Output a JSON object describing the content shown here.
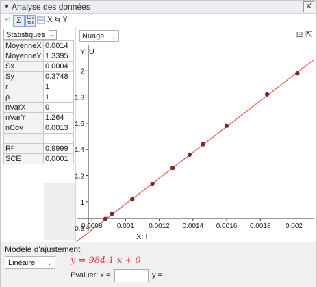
{
  "window": {
    "title": "Analyse des données",
    "collapse_icon": "triangle-down-icon",
    "close_icon": "close-icon"
  },
  "toolbar": {
    "swap_label": "X ⇆ Y"
  },
  "stats": {
    "selector": "Statistiques",
    "rows": [
      {
        "k": "MoyenneX",
        "v": "0.0014"
      },
      {
        "k": "MoyenneY",
        "v": "1.3395"
      },
      {
        "k": "Sx",
        "v": "0.0004"
      },
      {
        "k": "Sy",
        "v": "0.3748"
      },
      {
        "k": "r",
        "v": "1"
      },
      {
        "k": "ρ",
        "v": "1"
      },
      {
        "k": "nVarX",
        "v": "0"
      },
      {
        "k": "nVarY",
        "v": "1.264"
      },
      {
        "k": "nCov",
        "v": "0.0013"
      },
      {
        "k": "",
        "v": ""
      },
      {
        "k": "R²",
        "v": "0.9999"
      },
      {
        "k": "SCE",
        "v": "0.0001"
      }
    ]
  },
  "graph": {
    "view_selector": "Nuage"
  },
  "chart_data": {
    "type": "scatter",
    "xlabel": "X:  I",
    "ylabel": "Y:  U",
    "xlim": [
      0.00071,
      0.00212
    ],
    "ylim": [
      0.78,
      2.2
    ],
    "x_ticks": [
      0.0008,
      0.001,
      0.0012,
      0.0014,
      0.0016,
      0.0018,
      0.002
    ],
    "x_tick_labels": [
      "0.0008",
      "0.001",
      "0.0012",
      "0.0014",
      "0.0016",
      "0.0018",
      "0.002"
    ],
    "y_ticks": [
      0.8,
      1,
      1.2,
      1.4,
      1.6,
      1.8,
      2
    ],
    "y_tick_labels": [
      "0.8",
      "1",
      "1.2",
      "1.4",
      "1.6",
      "1.8",
      "2"
    ],
    "points": [
      {
        "x": 0.00088,
        "y": 0.87
      },
      {
        "x": 0.00092,
        "y": 0.91
      },
      {
        "x": 0.00104,
        "y": 1.02
      },
      {
        "x": 0.00116,
        "y": 1.14
      },
      {
        "x": 0.00128,
        "y": 1.26
      },
      {
        "x": 0.00138,
        "y": 1.36
      },
      {
        "x": 0.00146,
        "y": 1.44
      },
      {
        "x": 0.0016,
        "y": 1.58
      },
      {
        "x": 0.00184,
        "y": 1.82
      },
      {
        "x": 0.00202,
        "y": 1.98
      }
    ],
    "fit": {
      "slope": 984.1,
      "intercept": 0
    },
    "point_color": "#7a2a2a",
    "line_color": "#f25a5a",
    "grid": false
  },
  "model": {
    "label": "Modèle d'ajustement",
    "type": "Linéaire",
    "equation": "y = 984.1 x + 0",
    "evaluate_label": "Évaluer:  x =",
    "y_label": "y ="
  }
}
